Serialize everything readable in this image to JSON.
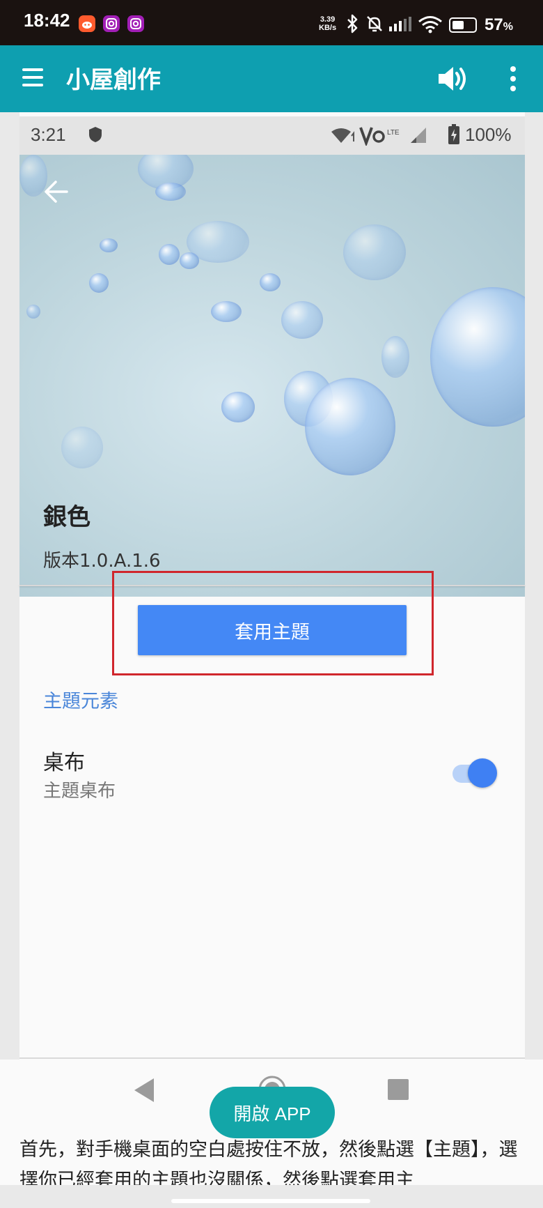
{
  "outer_status": {
    "time": "18:42",
    "notification_icons": [
      "reddit-icon",
      "instagram-icon",
      "instagram-icon"
    ],
    "net_speed_value": "3.39",
    "net_speed_unit": "KB/s",
    "battery": "57",
    "battery_unit": "%"
  },
  "app_bar": {
    "title": "小屋創作",
    "icons": [
      "menu-icon",
      "speaker-icon",
      "more-vert-icon"
    ]
  },
  "inner_status": {
    "time": "3:21",
    "battery": "100%"
  },
  "theme": {
    "name": "銀色",
    "version": "版本1.0.A.1.6",
    "apply_button": "套用主題",
    "section_label": "主題元素",
    "item_label": "桌布",
    "item_sublabel": "主題桌布",
    "toggle_on": true
  },
  "colors": {
    "app_bar": "#0e9fb0",
    "accent": "#4488f5",
    "highlight_box": "#d0262c",
    "open_app_button": "#13a6a8"
  },
  "footer": {
    "open_app_button": "開啟 APP"
  },
  "article": {
    "text": "首先，對手機桌面的空白處按住不放，然後點選【主題】，選擇你已經套用的主題也沒關係，然後點選套用主"
  }
}
